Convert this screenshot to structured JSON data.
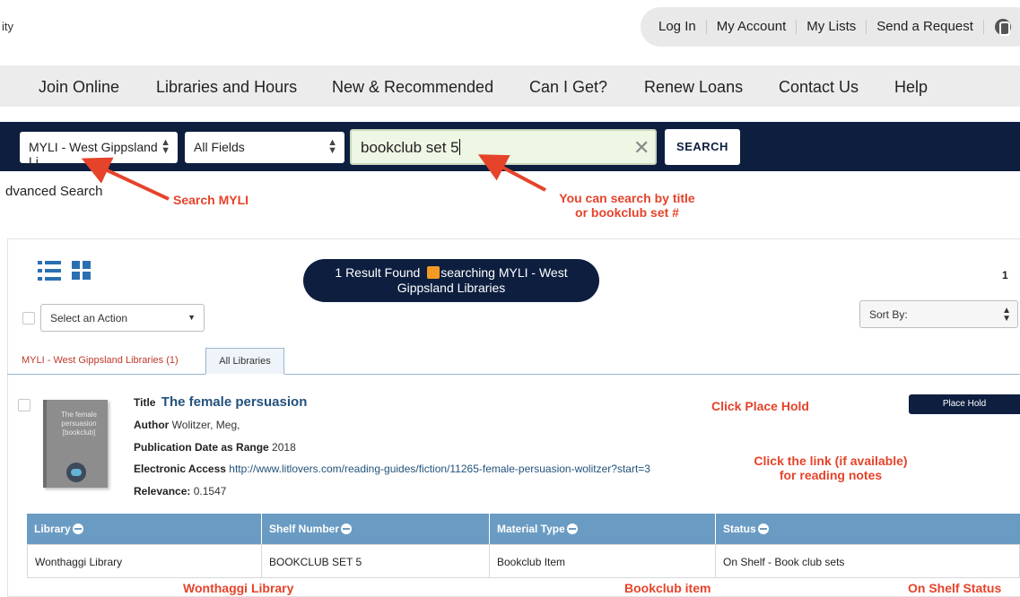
{
  "header": {
    "brand_fragment": "ity",
    "utility_links": [
      "Log In",
      "My Account",
      "My Lists",
      "Send a Request"
    ],
    "accessibility_icon": "accessibility-icon"
  },
  "nav": {
    "items": [
      "Join Online",
      "Libraries and Hours",
      "New & Recommended",
      "Can I Get?",
      "Renew Loans",
      "Contact Us",
      "Help"
    ]
  },
  "search": {
    "library_select": "MYLI - West Gippsland Li",
    "field_select": "All Fields",
    "query": "bookclub set 5",
    "button": "SEARCH",
    "advanced_link": "dvanced Search"
  },
  "annotations": {
    "search_myli": "Search MYLI",
    "search_hint_line1": "You can search by title",
    "search_hint_line2": "or bookclub set #",
    "place_hold": "Click Place Hold",
    "link_hint_line1": "Click the link (if available)",
    "link_hint_line2": "for reading notes",
    "library": "Wonthaggi Library",
    "material": "Bookclub item",
    "status": "On Shelf Status"
  },
  "results": {
    "found_text": "1 Result Found",
    "searching_line1": "searching MYLI - West",
    "searching_line2": "Gippsland Libraries",
    "page_number": "1",
    "action_select": "Select an Action",
    "sort_select": "Sort By:",
    "tabs": [
      "MYLI - West Gippsland Libraries (1)",
      "All Libraries"
    ]
  },
  "record": {
    "cover_text": "The female persuasion [bookclub]",
    "title_label": "Title",
    "title": "The female persuasion",
    "author_label": "Author",
    "author": "Wolitzer, Meg,",
    "pubdate_label": "Publication Date as Range",
    "pubdate": "2018",
    "access_label": "Electronic Access",
    "access_url": "http://www.litlovers.com/reading-guides/fiction/11265-female-persuasion-wolitzer?start=3",
    "relevance_label": "Relevance:",
    "relevance": "0.1547",
    "place_hold_button": "Place Hold"
  },
  "holdings": {
    "columns": [
      "Library",
      "Shelf Number",
      "Material Type",
      "Status"
    ],
    "rows": [
      [
        "Wonthaggi Library",
        "BOOKCLUB SET 5",
        "Bookclub Item",
        "On Shelf - Book club sets"
      ]
    ]
  },
  "colors": {
    "navy": "#0d1e3f",
    "annotation_red": "#e5432a",
    "table_header": "#6a9bc3",
    "link_blue": "#23527c"
  }
}
